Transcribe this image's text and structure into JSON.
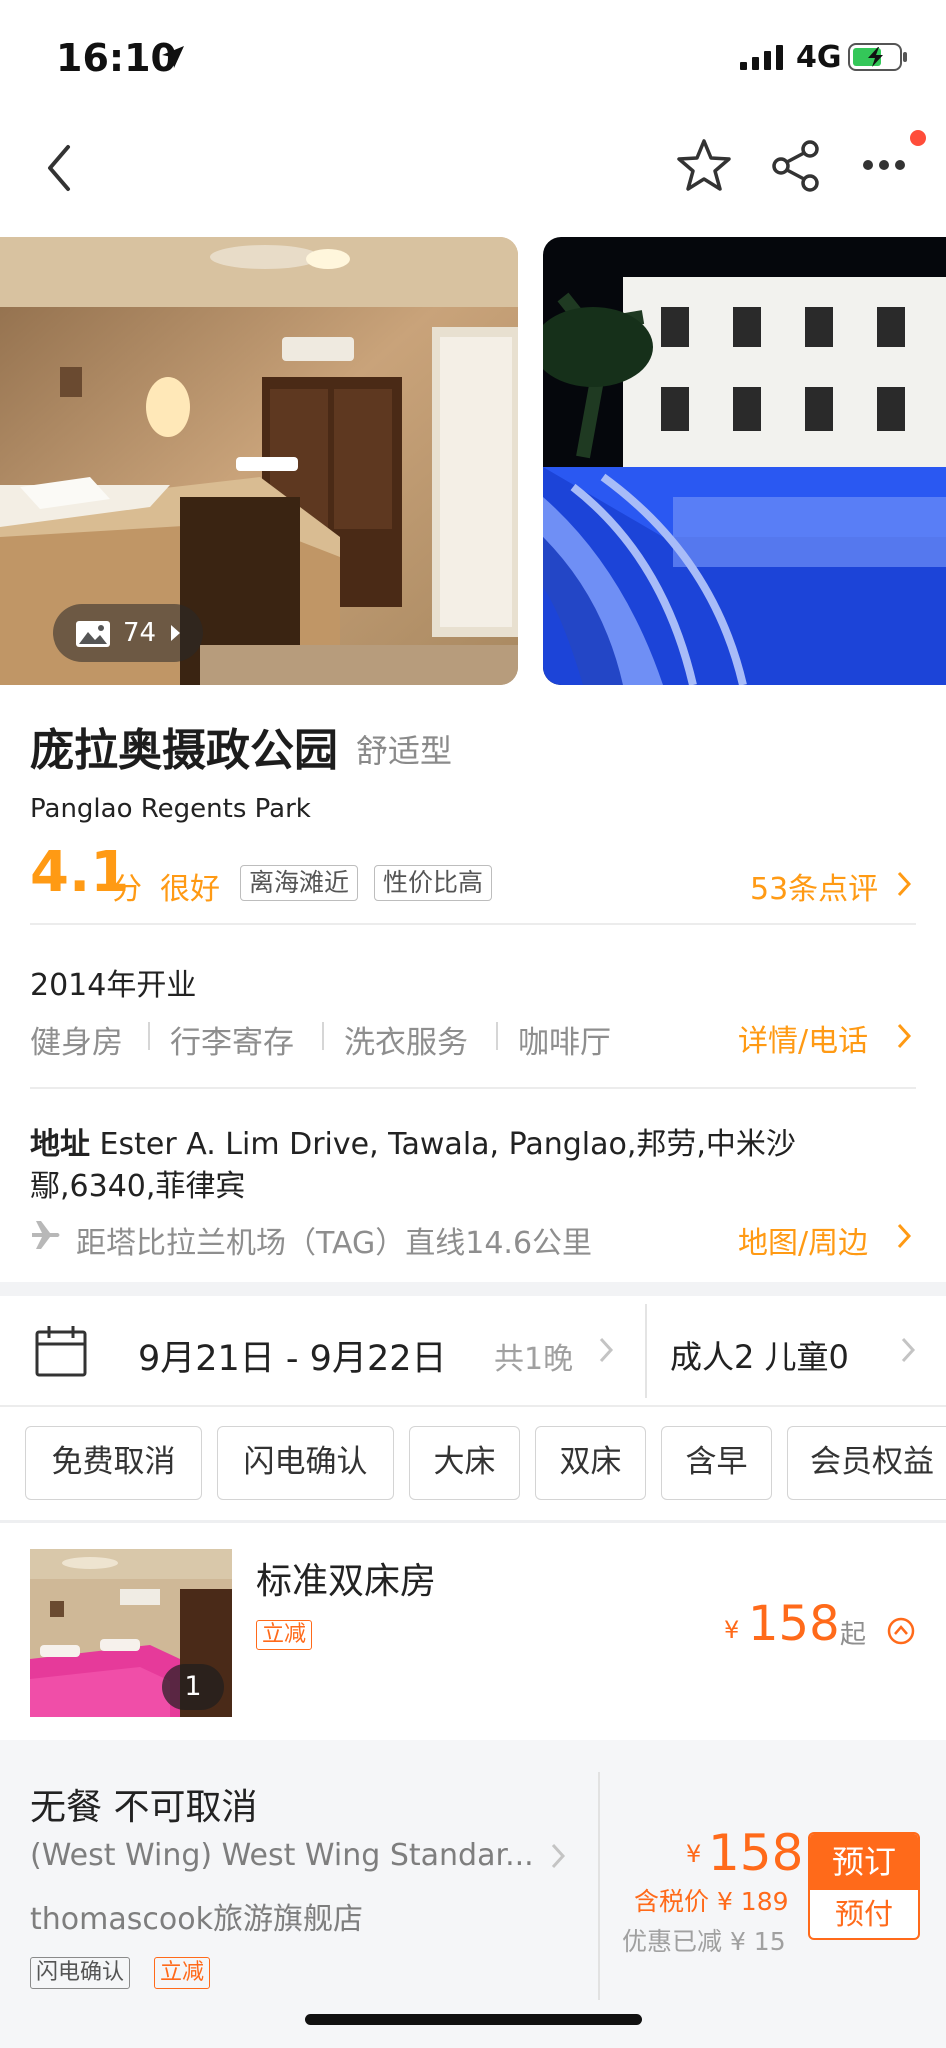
{
  "status_bar": {
    "time": "16:10",
    "network": "4G"
  },
  "gallery": {
    "photo_count": "74"
  },
  "hotel": {
    "name": "庞拉奥摄政公园",
    "type": "舒适型",
    "name_en": "Panglao Regents Park",
    "score": "4.1",
    "score_unit": "分",
    "score_word": "很好",
    "tags": [
      "离海滩近",
      "性价比高"
    ],
    "reviews_link": "53条点评",
    "opened": "2014年开业",
    "facilities": [
      "健身房",
      "行李寄存",
      "洗衣服务",
      "咖啡厅"
    ],
    "details_link": "详情/电话",
    "address_label": "地址",
    "address": "Ester A. Lim Drive, Tawala, Panglao,邦劳,中米沙鄢,6340,菲律宾",
    "distance": "距塔比拉兰机场（TAG）直线14.6公里",
    "map_link": "地图/周边"
  },
  "booking": {
    "dates": "9月21日 - 9月22日",
    "nights": "共1晚",
    "guests": "成人2 儿童0"
  },
  "filters": [
    "免费取消",
    "闪电确认",
    "大床",
    "双床",
    "含早",
    "会员权益"
  ],
  "room": {
    "name": "标准双床房",
    "promo": "立减",
    "thumb_count": "1",
    "currency": "¥",
    "price": "158",
    "price_suffix": "起"
  },
  "rate": {
    "title": "无餐 不可取消",
    "room_desc": "(West Wing) West Wing Standar...",
    "vendor": "thomascook旅游旗舰店",
    "tags": [
      "闪电确认",
      "立减"
    ],
    "currency": "¥",
    "price": "158",
    "tax_price": "含税价 ¥ 189",
    "discount": "优惠已减 ¥ 15",
    "book_label": "预订",
    "pay_label": "预付"
  },
  "colors": {
    "accent": "#ff9a14",
    "price": "#ff6a1a"
  }
}
